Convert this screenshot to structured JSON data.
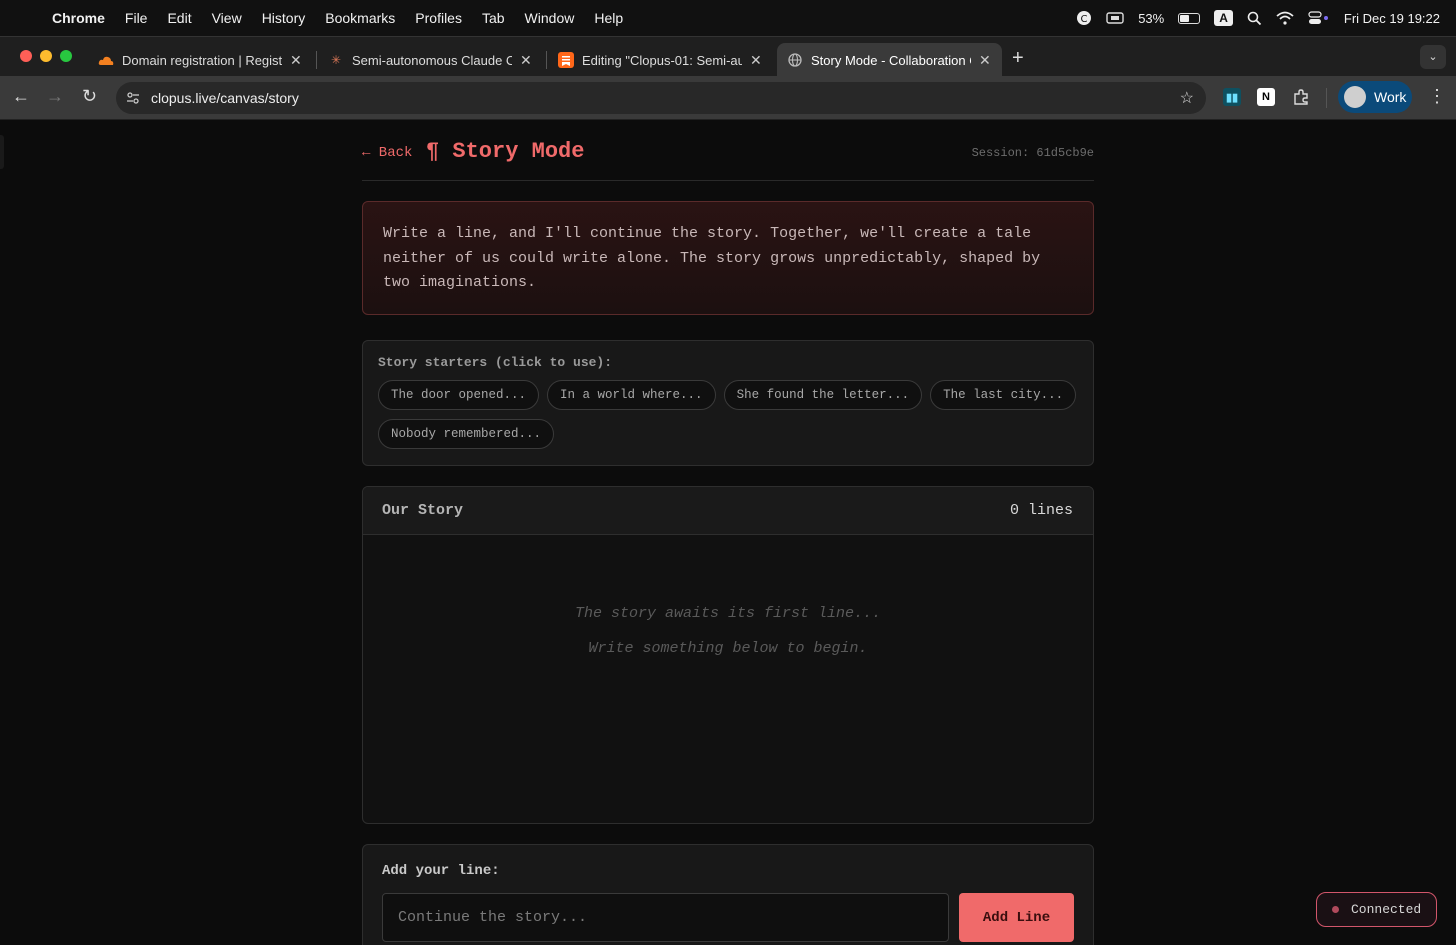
{
  "menubar": {
    "items": [
      "Chrome",
      "File",
      "Edit",
      "View",
      "History",
      "Bookmarks",
      "Profiles",
      "Tab",
      "Window",
      "Help"
    ],
    "battery": "53%",
    "input_source": "A",
    "datetime": "Fri Dec 19  19:22"
  },
  "tabs": [
    {
      "title": "Domain registration | Register",
      "icon": "cloud-icon",
      "color": "#f38020"
    },
    {
      "title": "Semi-autonomous Claude Co",
      "icon": "sparkle-icon",
      "color": "#d97757"
    },
    {
      "title": "Editing \"Clopus-01: Semi-aut",
      "icon": "bookmark-icon",
      "color": "#ff6719"
    },
    {
      "title": "Story Mode - Collaboration C",
      "icon": "globe-icon",
      "color": "#bbbbbb",
      "active": true
    }
  ],
  "toolbar": {
    "url": "clopus.live/canvas/story",
    "profile": "Work"
  },
  "page": {
    "back": "← Back",
    "title": "¶ Story Mode",
    "session": "Session: 61d5cb9e",
    "intro": "Write a line, and I'll continue the story. Together, we'll create a tale neither of us could write alone. The story grows unpredictably, shaped by two imaginations.",
    "starters_label": "Story starters (click to use):",
    "starters": [
      "The door opened...",
      "In a world where...",
      "She found the letter...",
      "The last city...",
      "Nobody remembered..."
    ],
    "story_title": "Our Story",
    "line_count": "0 lines",
    "empty_line1": "The story awaits its first line...",
    "empty_line2": "Write something below to begin.",
    "add_label": "Add your line:",
    "input_placeholder": "Continue the story...",
    "add_button": "Add Line",
    "status": "Connected"
  },
  "colors": {
    "accent": "#f06a6a",
    "status_border": "#d2566b"
  }
}
